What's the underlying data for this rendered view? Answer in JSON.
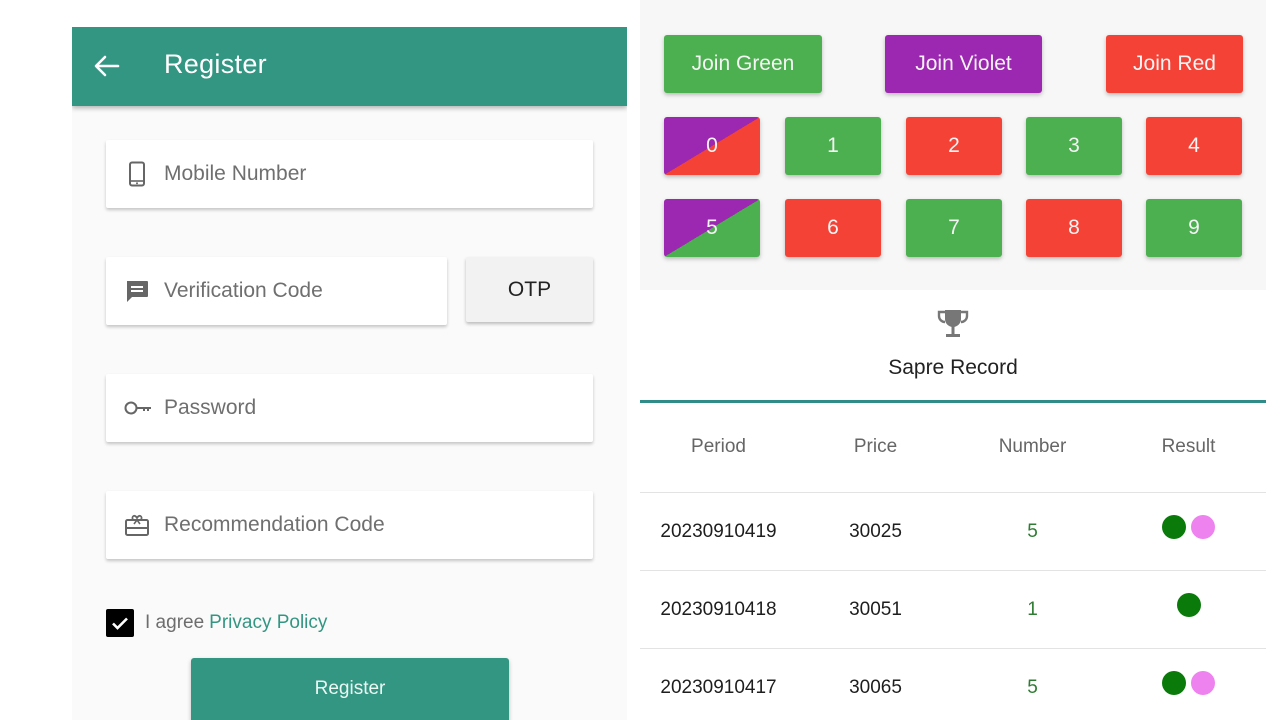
{
  "register": {
    "title": "Register",
    "fields": {
      "mobile_placeholder": "Mobile Number",
      "verification_placeholder": "Verification Code",
      "password_placeholder": "Password",
      "recommendation_placeholder": "Recommendation Code"
    },
    "otp_label": "OTP",
    "agree_checked": true,
    "agree_text": "I agree",
    "privacy_link": "Privacy Policy",
    "register_label": "Register",
    "colors": {
      "primary": "#339682"
    }
  },
  "game": {
    "join_buttons": [
      {
        "label": "Join Green",
        "color": "#4caf50"
      },
      {
        "label": "Join Violet",
        "color": "#9c27b0"
      },
      {
        "label": "Join Red",
        "color": "#f44336"
      }
    ],
    "numbers": [
      {
        "label": "0",
        "colors": [
          "#9c27b0",
          "#f44336"
        ]
      },
      {
        "label": "1",
        "colors": [
          "#4caf50"
        ]
      },
      {
        "label": "2",
        "colors": [
          "#f44336"
        ]
      },
      {
        "label": "3",
        "colors": [
          "#4caf50"
        ]
      },
      {
        "label": "4",
        "colors": [
          "#f44336"
        ]
      },
      {
        "label": "5",
        "colors": [
          "#9c27b0",
          "#4caf50"
        ]
      },
      {
        "label": "6",
        "colors": [
          "#f44336"
        ]
      },
      {
        "label": "7",
        "colors": [
          "#4caf50"
        ]
      },
      {
        "label": "8",
        "colors": [
          "#f44336"
        ]
      },
      {
        "label": "9",
        "colors": [
          "#4caf50"
        ]
      }
    ],
    "record": {
      "icon": "trophy-icon",
      "title": "Sapre Record",
      "columns": [
        "Period",
        "Price",
        "Number",
        "Result"
      ],
      "rows": [
        {
          "period": "20230910419",
          "price": "30025",
          "number": "5",
          "result": [
            "#0a7a0a",
            "#ee82ee"
          ]
        },
        {
          "period": "20230910418",
          "price": "30051",
          "number": "1",
          "result": [
            "#0a7a0a"
          ]
        },
        {
          "period": "20230910417",
          "price": "30065",
          "number": "5",
          "result": [
            "#0a7a0a",
            "#ee82ee"
          ]
        }
      ]
    }
  }
}
